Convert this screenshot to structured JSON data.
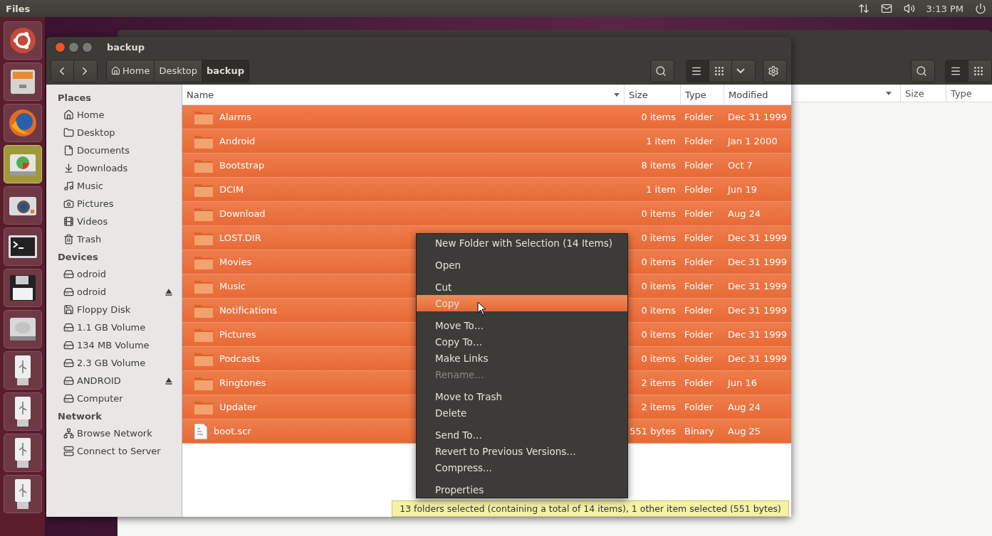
{
  "top_bar": {
    "app_title": "Files",
    "clock": "3:13 PM"
  },
  "launcher": [
    {
      "kind": "ubuntu",
      "selected": false
    },
    {
      "kind": "files",
      "selected": false
    },
    {
      "kind": "browser",
      "selected": false
    },
    {
      "kind": "disk-usage",
      "selected": true
    },
    {
      "kind": "camera",
      "selected": false
    },
    {
      "kind": "terminal",
      "selected": false
    },
    {
      "kind": "floppy",
      "selected": false
    },
    {
      "kind": "harddisk",
      "selected": false
    },
    {
      "kind": "usb",
      "selected": false
    },
    {
      "kind": "usb",
      "selected": false
    },
    {
      "kind": "usb",
      "selected": false
    },
    {
      "kind": "usb",
      "selected": false
    }
  ],
  "back_window": {
    "columns": [
      "Size",
      "Type"
    ]
  },
  "window": {
    "title": "backup",
    "breadcrumbs": [
      {
        "label": "Home",
        "kind": "home",
        "selected": false
      },
      {
        "label": "Desktop",
        "kind": "plain",
        "selected": false
      },
      {
        "label": "backup",
        "kind": "plain",
        "selected": true
      }
    ],
    "view_buttons": [
      {
        "kind": "list",
        "selected": true
      },
      {
        "kind": "grid",
        "selected": false
      }
    ],
    "sidebar": [
      {
        "title": "Places",
        "items": [
          {
            "label": "Home",
            "kind": "home",
            "eject": false
          },
          {
            "label": "Desktop",
            "kind": "desktop",
            "eject": false
          },
          {
            "label": "Documents",
            "kind": "document",
            "eject": false
          },
          {
            "label": "Downloads",
            "kind": "download",
            "eject": false
          },
          {
            "label": "Music",
            "kind": "music",
            "eject": false
          },
          {
            "label": "Pictures",
            "kind": "camera",
            "eject": false
          },
          {
            "label": "Videos",
            "kind": "film",
            "eject": false
          },
          {
            "label": "Trash",
            "kind": "trash",
            "eject": false
          }
        ]
      },
      {
        "title": "Devices",
        "items": [
          {
            "label": "odroid",
            "kind": "drive",
            "eject": false
          },
          {
            "label": "odroid",
            "kind": "drive",
            "eject": true
          },
          {
            "label": "Floppy Disk",
            "kind": "floppy",
            "eject": false
          },
          {
            "label": "1.1 GB Volume",
            "kind": "volume",
            "eject": false
          },
          {
            "label": "134 MB Volume",
            "kind": "volume",
            "eject": false
          },
          {
            "label": "2.3 GB Volume",
            "kind": "volume",
            "eject": false
          },
          {
            "label": "ANDROID",
            "kind": "volume",
            "eject": true
          },
          {
            "label": "Computer",
            "kind": "drive",
            "eject": false
          }
        ]
      },
      {
        "title": "Network",
        "items": [
          {
            "label": "Browse Network",
            "kind": "network",
            "eject": false
          },
          {
            "label": "Connect to Server",
            "kind": "server",
            "eject": false
          }
        ]
      }
    ],
    "columns": [
      "Name",
      "Size",
      "Type",
      "Modified"
    ],
    "rows": [
      {
        "name": "Alarms",
        "size": "0 items",
        "type": "Folder",
        "modified": "Dec 31 1999",
        "kind": "folder",
        "selected": true
      },
      {
        "name": "Android",
        "size": "1 item",
        "type": "Folder",
        "modified": "Jan 1 2000",
        "kind": "folder",
        "selected": true
      },
      {
        "name": "Bootstrap",
        "size": "8 items",
        "type": "Folder",
        "modified": "Oct 7",
        "kind": "folder",
        "selected": true
      },
      {
        "name": "DCIM",
        "size": "1 item",
        "type": "Folder",
        "modified": "Jun 19",
        "kind": "folder",
        "selected": true
      },
      {
        "name": "Download",
        "size": "0 items",
        "type": "Folder",
        "modified": "Aug 24",
        "kind": "folder",
        "selected": true
      },
      {
        "name": "LOST.DIR",
        "size": "0 items",
        "type": "Folder",
        "modified": "Dec 31 1999",
        "kind": "folder",
        "selected": true
      },
      {
        "name": "Movies",
        "size": "0 items",
        "type": "Folder",
        "modified": "Dec 31 1999",
        "kind": "folder",
        "selected": true
      },
      {
        "name": "Music",
        "size": "0 items",
        "type": "Folder",
        "modified": "Dec 31 1999",
        "kind": "folder",
        "selected": true
      },
      {
        "name": "Notifications",
        "size": "0 items",
        "type": "Folder",
        "modified": "Dec 31 1999",
        "kind": "folder",
        "selected": true
      },
      {
        "name": "Pictures",
        "size": "0 items",
        "type": "Folder",
        "modified": "Dec 31 1999",
        "kind": "folder",
        "selected": true
      },
      {
        "name": "Podcasts",
        "size": "0 items",
        "type": "Folder",
        "modified": "Dec 31 1999",
        "kind": "folder",
        "selected": true
      },
      {
        "name": "Ringtones",
        "size": "2 items",
        "type": "Folder",
        "modified": "Jun 16",
        "kind": "folder",
        "selected": true
      },
      {
        "name": "Updater",
        "size": "2 items",
        "type": "Folder",
        "modified": "Aug 24",
        "kind": "folder",
        "selected": true
      },
      {
        "name": "boot.scr",
        "size": "551 bytes",
        "type": "Binary",
        "modified": "Aug 25",
        "kind": "binary",
        "selected": true
      }
    ],
    "status": "13 folders selected (containing a total of 14 items), 1 other item selected (551 bytes)"
  },
  "context_menu": [
    [
      {
        "label": "New Folder with Selection (14 Items)",
        "disabled": false,
        "selected": false
      }
    ],
    [
      {
        "label": "Open",
        "disabled": false,
        "selected": false
      }
    ],
    [
      {
        "label": "Cut",
        "disabled": false,
        "selected": false
      },
      {
        "label": "Copy",
        "disabled": false,
        "selected": true
      }
    ],
    [
      {
        "label": "Move To…",
        "disabled": false,
        "selected": false
      },
      {
        "label": "Copy To…",
        "disabled": false,
        "selected": false
      },
      {
        "label": "Make Links",
        "disabled": false,
        "selected": false
      },
      {
        "label": "Rename…",
        "disabled": true,
        "selected": false
      }
    ],
    [
      {
        "label": "Move to Trash",
        "disabled": false,
        "selected": false
      },
      {
        "label": "Delete",
        "disabled": false,
        "selected": false
      }
    ],
    [
      {
        "label": "Send To…",
        "disabled": false,
        "selected": false
      },
      {
        "label": "Revert to Previous Versions…",
        "disabled": false,
        "selected": false
      },
      {
        "label": "Compress...",
        "disabled": false,
        "selected": false
      }
    ],
    [
      {
        "label": "Properties",
        "disabled": false,
        "selected": false
      }
    ]
  ]
}
